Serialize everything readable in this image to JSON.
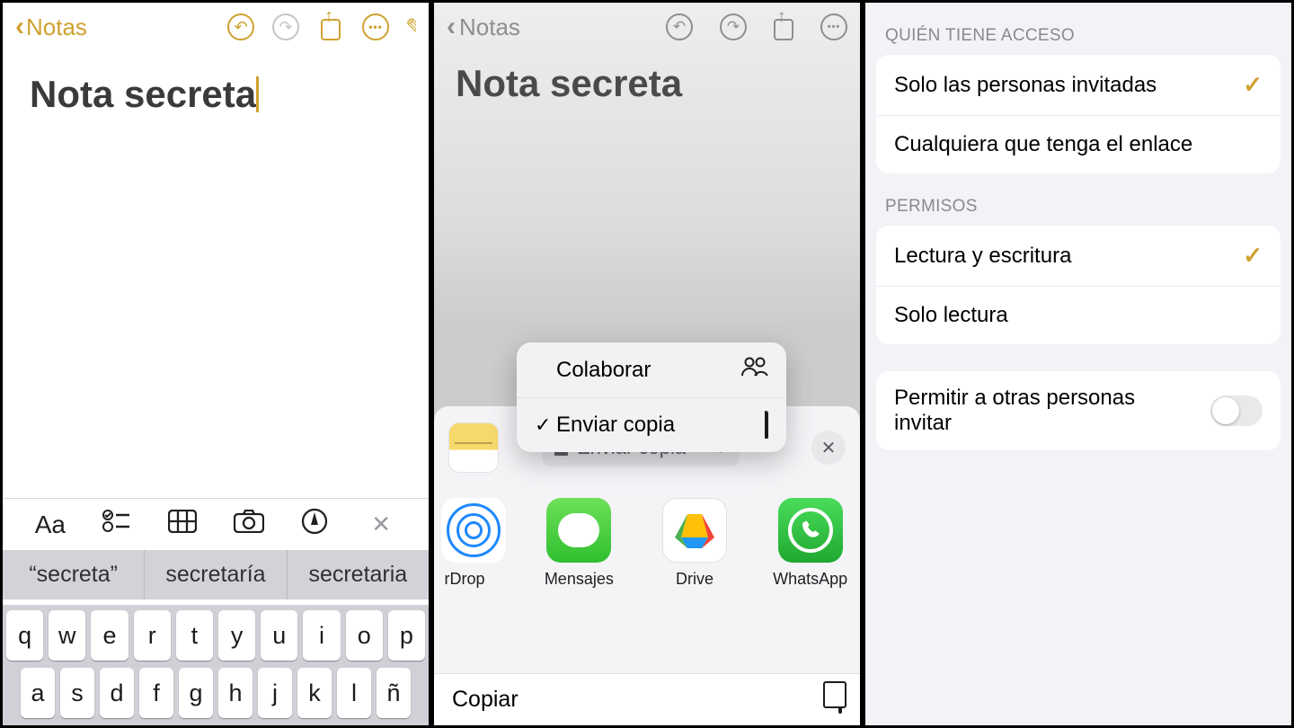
{
  "panel1": {
    "back_label": "Notas",
    "title": "Nota secreta",
    "toolbar": {
      "aa": "Aa"
    },
    "suggestions": [
      "“secreta”",
      "secretaría",
      "secretaria"
    ],
    "keyboard_row1": [
      "q",
      "w",
      "e",
      "r",
      "t",
      "y",
      "u",
      "i",
      "o",
      "p"
    ],
    "keyboard_row2": [
      "a",
      "s",
      "d",
      "f",
      "g",
      "h",
      "j",
      "k",
      "l",
      "ñ"
    ]
  },
  "panel2": {
    "back_label": "Notas",
    "title": "Nota secreta",
    "popup": {
      "collaborate": "Colaborar",
      "send_copy": "Enviar copia"
    },
    "pill_label": "Enviar copia",
    "apps": {
      "airdrop": "rDrop",
      "messages": "Mensajes",
      "drive": "Drive",
      "whatsapp": "WhatsApp"
    },
    "copy_label": "Copiar"
  },
  "panel3": {
    "access_header": "Quién tiene acceso",
    "access_opts": {
      "invited": "Solo las personas invitadas",
      "anyone": "Cualquiera que tenga el enlace"
    },
    "perm_header": "Permisos",
    "perm_opts": {
      "rw": "Lectura y escritura",
      "ro": "Solo lectura"
    },
    "allow_invite": "Permitir a otras personas invitar"
  }
}
